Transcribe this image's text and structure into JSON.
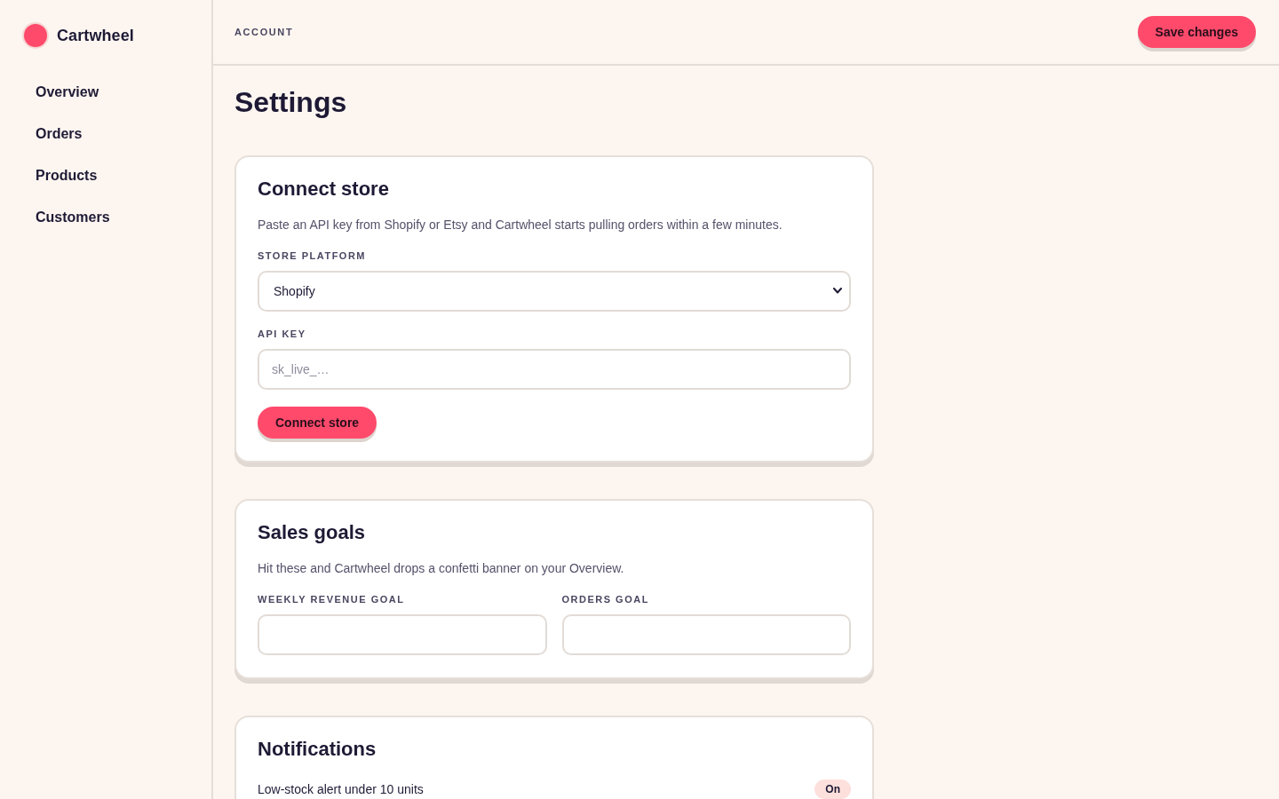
{
  "sidebar": {
    "brand": "Cartwheel",
    "items": [
      {
        "label": "Overview",
        "selected": false
      },
      {
        "label": "Orders",
        "selected": false
      },
      {
        "label": "Products",
        "selected": false
      },
      {
        "label": "Customers",
        "selected": false
      }
    ]
  },
  "header": {
    "breadcrumb": "ACCOUNT",
    "save_button": "Save changes"
  },
  "page_title": "Settings",
  "sections": [
    {
      "kind": "stack",
      "title": "Connect store",
      "description": "Paste an API key from Shopify or Etsy and Cartwheel starts pulling orders within a few minutes.",
      "fields": [
        {
          "kind": "select",
          "label": "STORE PLATFORM",
          "value": "Shopify"
        },
        {
          "kind": "input",
          "label": "API KEY",
          "placeholder": "sk_live_…"
        }
      ],
      "button": "Connect store"
    },
    {
      "kind": "columns",
      "title": "Sales goals",
      "description": "Hit these and Cartwheel drops a confetti banner on your Overview.",
      "fields": [
        {
          "kind": "input",
          "label": "WEEKLY REVENUE GOAL"
        },
        {
          "kind": "input",
          "label": "ORDERS GOAL"
        }
      ]
    },
    {
      "kind": "toggles",
      "title": "Notifications",
      "rows": [
        {
          "label": "Low-stock alert under 10 units",
          "status": "On",
          "on": true
        }
      ]
    }
  ]
}
